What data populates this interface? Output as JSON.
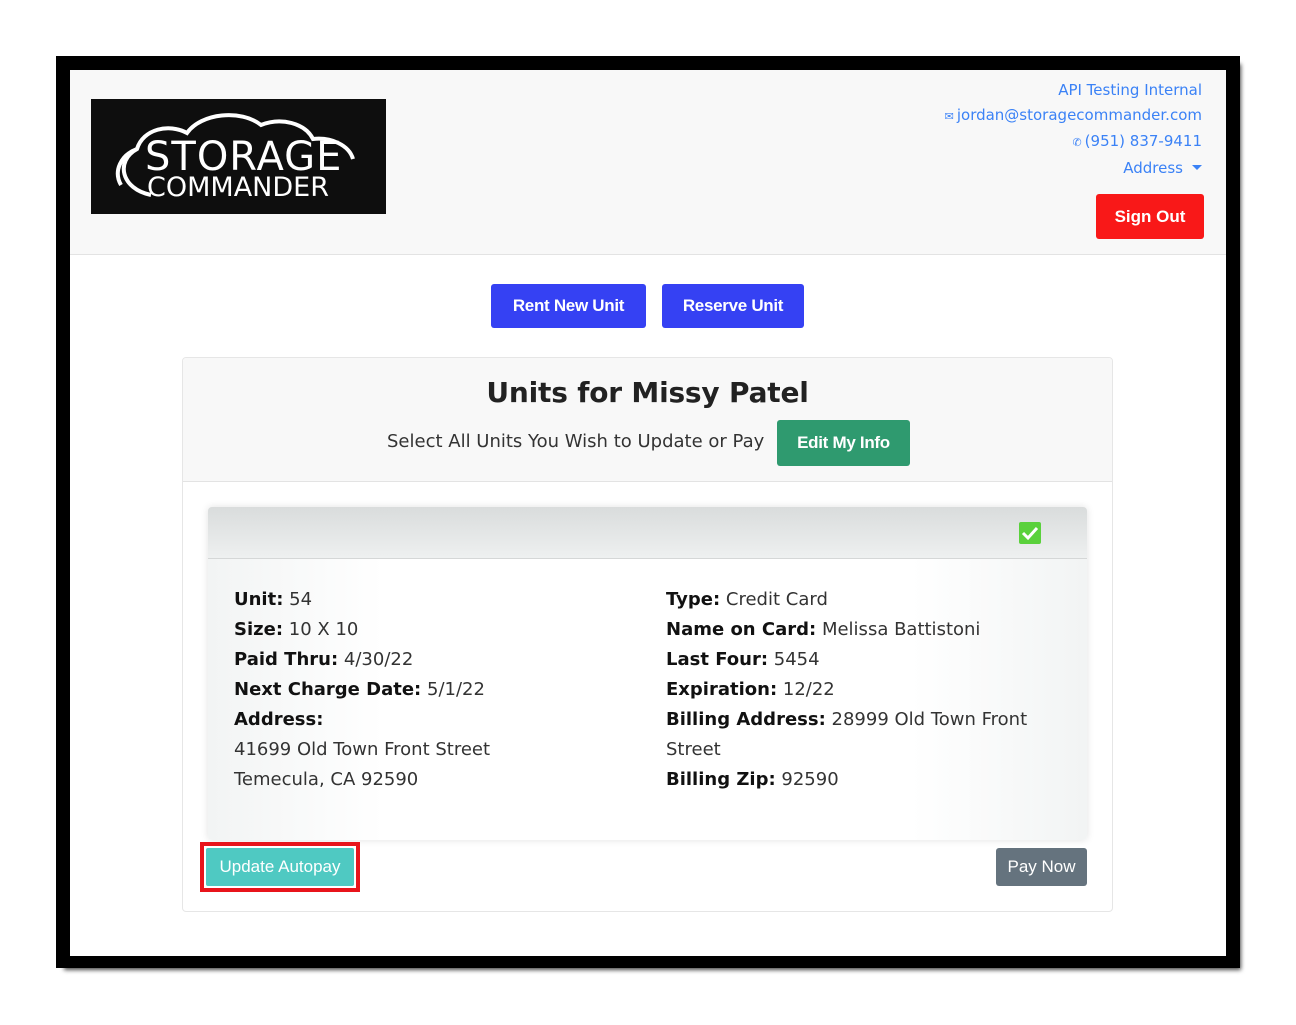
{
  "header": {
    "logo_text_top": "STORAGE",
    "logo_text_bottom": "COMMANDER",
    "account_name": "API Testing Internal",
    "email": "jordan@storagecommander.com",
    "phone": "(951) 837-9411",
    "address_menu": "Address",
    "signout_label": "Sign Out"
  },
  "actions": {
    "rent_label": "Rent New Unit",
    "reserve_label": "Reserve Unit"
  },
  "units": {
    "title": "Units for Missy Patel",
    "instruction": "Select All Units You Wish to Update or Pay",
    "edit_label": "Edit My Info"
  },
  "unit": {
    "selected": true,
    "left": {
      "unit_label": "Unit:",
      "unit_value": "54",
      "size_label": "Size:",
      "size_value": "10 X 10",
      "paid_label": "Paid Thru:",
      "paid_value": "4/30/22",
      "next_label": "Next Charge Date:",
      "next_value": "5/1/22",
      "address_label": "Address:",
      "address_line1": "41699 Old Town Front Street",
      "address_line2": "Temecula, CA 92590"
    },
    "right": {
      "type_label": "Type:",
      "type_value": "Credit Card",
      "name_label": "Name on Card:",
      "name_value": "Melissa Battistoni",
      "last_label": "Last Four:",
      "last_value": "5454",
      "exp_label": "Expiration:",
      "exp_value": "12/22",
      "billing_label": "Billing Address:",
      "billing_value": "28999 Old Town Front Street",
      "zip_label": "Billing Zip:",
      "zip_value": "92590"
    },
    "update_label": "Update Autopay",
    "pay_label": "Pay Now"
  },
  "icons": {
    "envelope": "envelope-icon",
    "phone": "phone-icon",
    "checkbox": "check-icon"
  },
  "colors": {
    "link": "#3b82f6",
    "signout": "#f91818",
    "primary": "#3541f3",
    "edit": "#2f9a6f",
    "update": "#4fc9c2",
    "highlight": "#e8141b",
    "pay": "#65737e",
    "checkbox": "#5ad13c"
  }
}
